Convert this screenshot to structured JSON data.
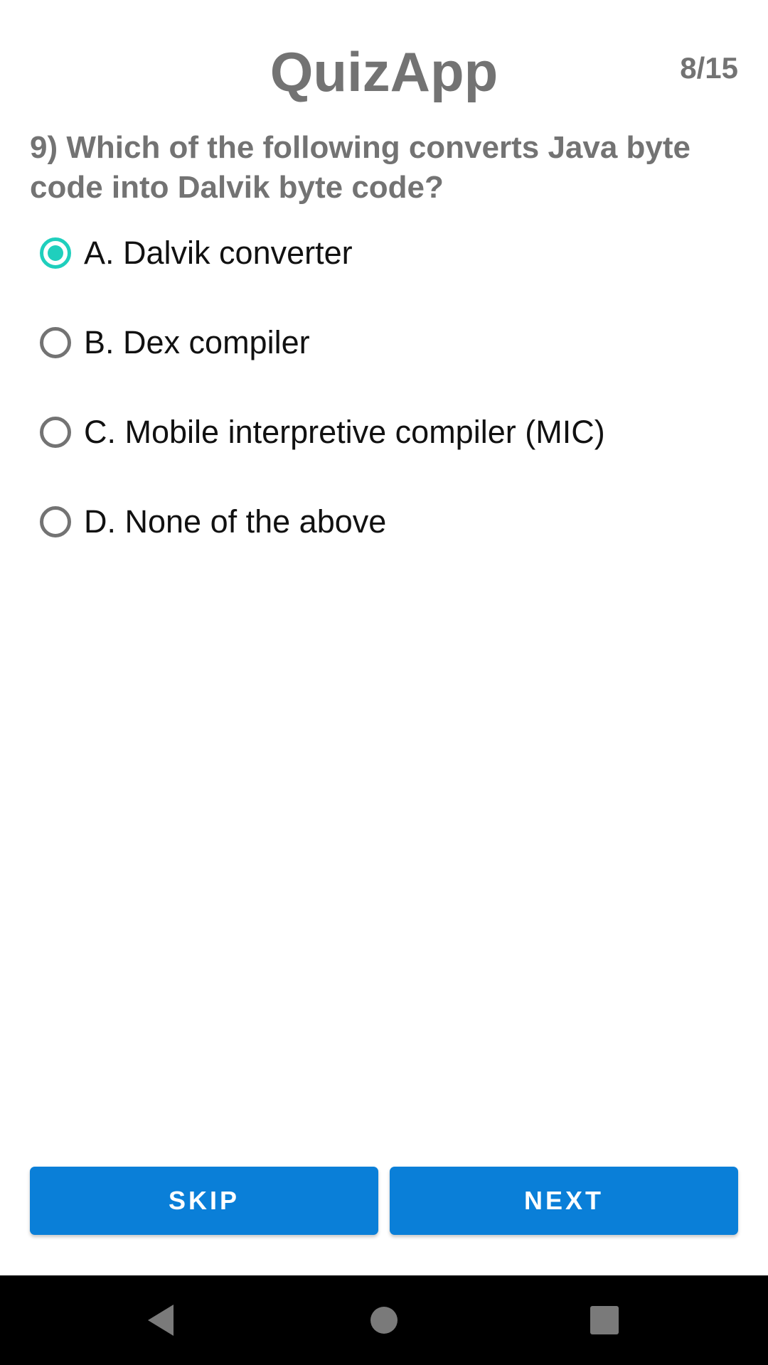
{
  "header": {
    "title": "QuizApp",
    "progress": "8/15"
  },
  "question": {
    "text": "9) Which of the following converts Java byte code into Dalvik byte code?"
  },
  "options": [
    {
      "label": "A. Dalvik converter",
      "selected": true
    },
    {
      "label": "B. Dex compiler",
      "selected": false
    },
    {
      "label": "C. Mobile interpretive compiler (MIC)",
      "selected": false
    },
    {
      "label": "D. None of the above",
      "selected": false
    }
  ],
  "buttons": {
    "skip_label": "SKIP",
    "next_label": "NEXT"
  },
  "nav": {
    "back_icon": "back-triangle-icon",
    "home_icon": "home-circle-icon",
    "recents_icon": "recents-square-icon"
  },
  "colors": {
    "accent": "#1fcfbd",
    "button": "#0a7fd8",
    "title_gray": "#737373"
  }
}
